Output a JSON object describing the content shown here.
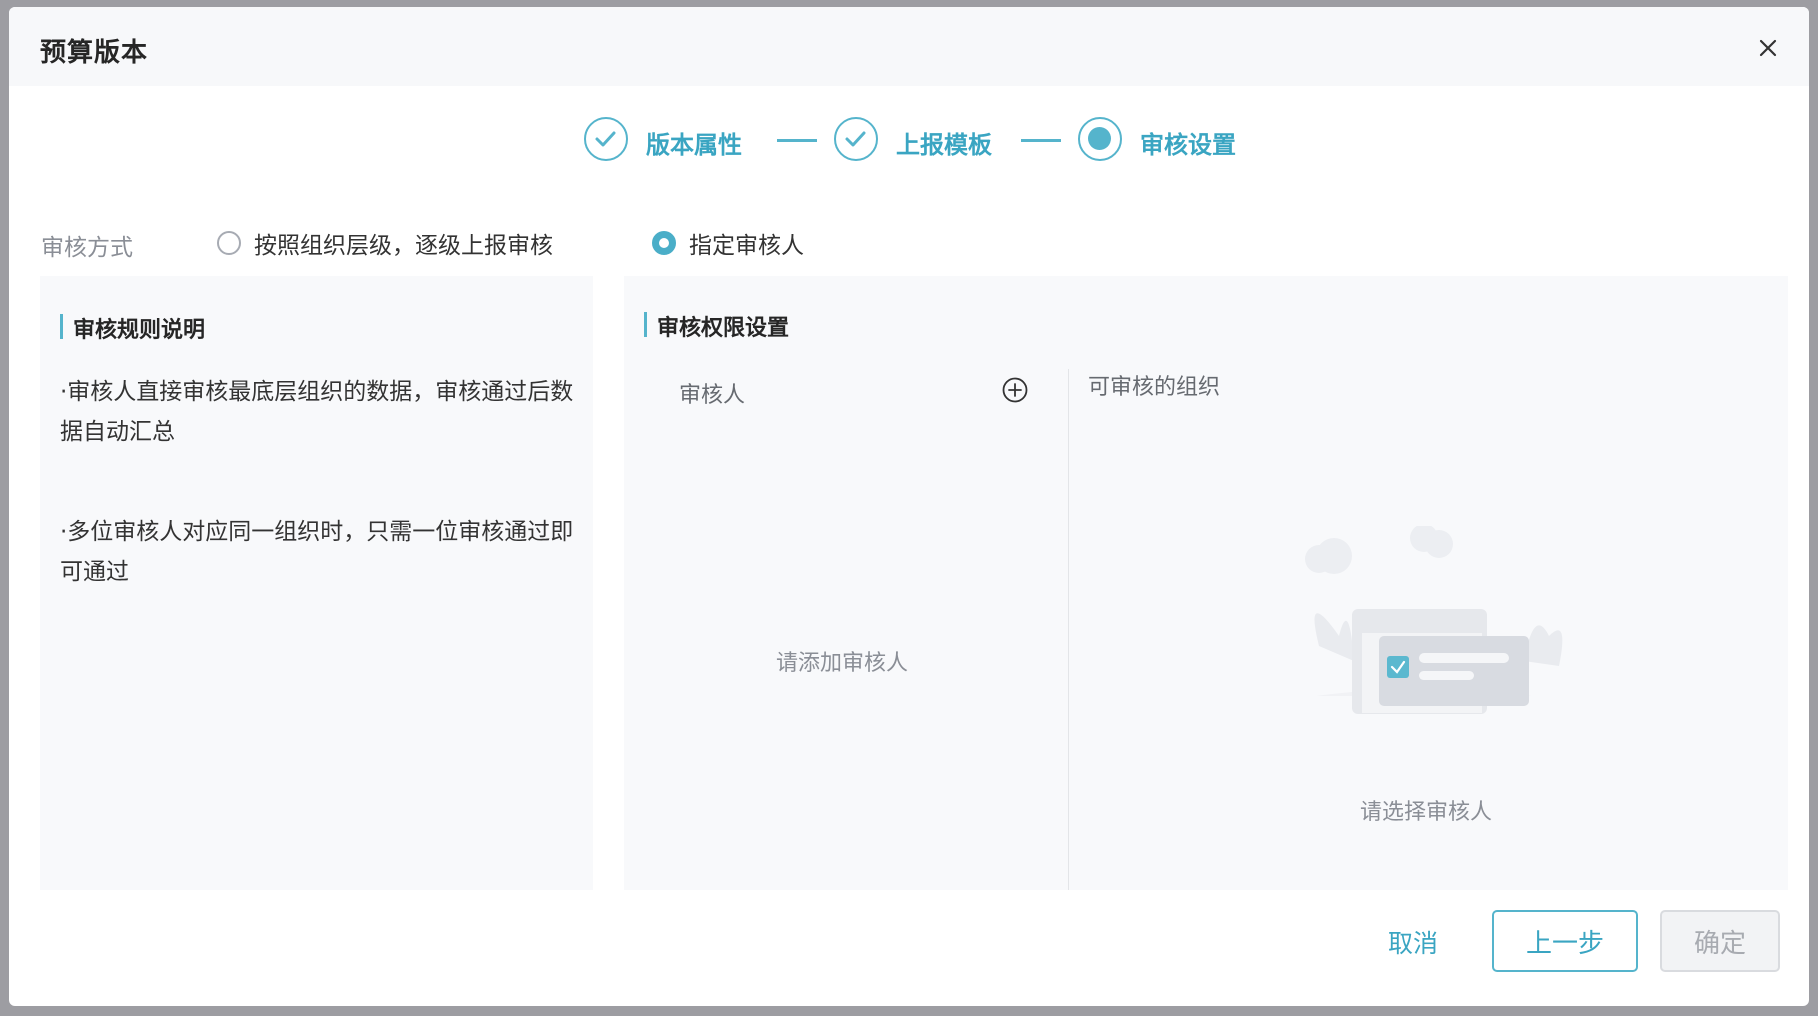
{
  "dialog": {
    "title": "预算版本",
    "close_icon": "close-icon"
  },
  "steps": [
    {
      "label": "版本属性",
      "status": "done",
      "icon": "check-icon"
    },
    {
      "label": "上报模板",
      "status": "done",
      "icon": "check-icon"
    },
    {
      "label": "审核设置",
      "status": "active",
      "icon": "dot-icon"
    }
  ],
  "review_mode": {
    "label": "审核方式",
    "options": [
      {
        "label": "按照组织层级，逐级上报审核",
        "checked": false
      },
      {
        "label": "指定审核人",
        "checked": true
      }
    ]
  },
  "rules": {
    "title": "审核规则说明",
    "items": [
      "·审核人直接审核最底层组织的数据，审核通过后数据自动汇总",
      "·多位审核人对应同一组织时，只需一位审核通过即可通过"
    ]
  },
  "permissions": {
    "title": "审核权限设置",
    "reviewer_header": "审核人",
    "add_icon": "plus-circle-icon",
    "reviewer_empty": "请添加审核人",
    "org_header": "可审核的组织",
    "org_empty_icon": "empty-state-illustration",
    "org_empty": "请选择审核人"
  },
  "footer": {
    "cancel": "取消",
    "prev": "上一步",
    "confirm": "确定"
  },
  "colors": {
    "accent": "#55b4cc",
    "accent_text": "#3aa5c2"
  }
}
